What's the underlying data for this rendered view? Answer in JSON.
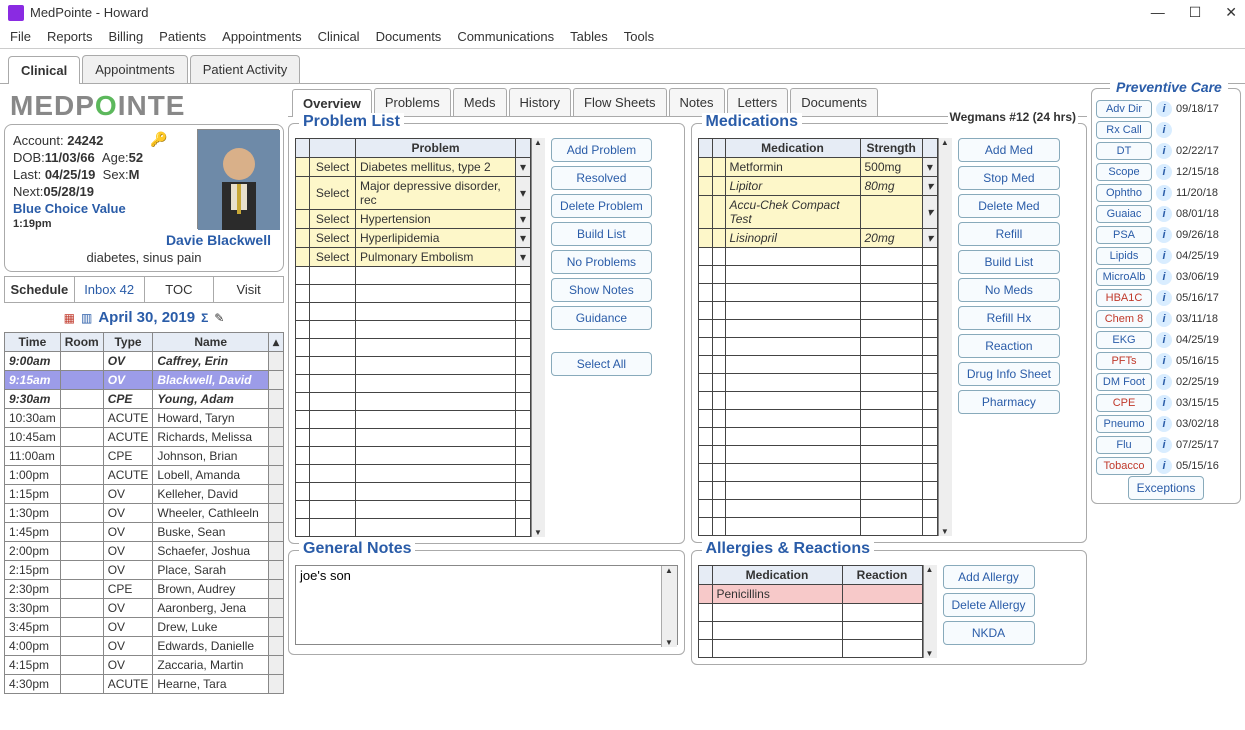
{
  "window": {
    "title": "MedPointe  -  Howard"
  },
  "menubar": [
    "File",
    "Reports",
    "Billing",
    "Patients",
    "Appointments",
    "Clinical",
    "Documents",
    "Communications",
    "Tables",
    "Tools"
  ],
  "main_tabs": [
    "Clinical",
    "Appointments",
    "Patient Activity"
  ],
  "logo": {
    "pre": "MEDP",
    "o": "O",
    "post": "INTE"
  },
  "patient": {
    "account_label": "Account:",
    "account": "24242",
    "dob_label": "DOB:",
    "dob": "11/03/66",
    "age_label": "Age:",
    "age": "52",
    "last_label": "Last:",
    "last": "04/25/19",
    "sex_label": "Sex:",
    "sex": "M",
    "next_label": "Next:",
    "next": "05/28/19",
    "plan": "Blue Choice Value",
    "time": "1:19pm",
    "name": "Davie Blackwell",
    "cc": "diabetes, sinus pain"
  },
  "left_subtabs": {
    "schedule": "Schedule",
    "inbox": "Inbox 42",
    "toc": "TOC",
    "visit": "Visit"
  },
  "date_header": "April 30, 2019",
  "sched_headers": [
    "Time",
    "Room",
    "Type",
    "Name"
  ],
  "schedule": [
    {
      "time": "9:00am",
      "room": "",
      "type": "OV",
      "name": "Caffrey, Erin",
      "bold": true
    },
    {
      "time": "9:15am",
      "room": "",
      "type": "OV",
      "name": "Blackwell, David",
      "selected": true
    },
    {
      "time": "9:30am",
      "room": "",
      "type": "CPE",
      "name": "Young, Adam",
      "bold": true
    },
    {
      "time": "10:30am",
      "room": "",
      "type": "ACUTE",
      "name": "Howard, Taryn"
    },
    {
      "time": "10:45am",
      "room": "",
      "type": "ACUTE",
      "name": "Richards, Melissa"
    },
    {
      "time": "11:00am",
      "room": "",
      "type": "CPE",
      "name": "Johnson, Brian"
    },
    {
      "time": "1:00pm",
      "room": "",
      "type": "ACUTE",
      "name": "Lobell, Amanda"
    },
    {
      "time": "1:15pm",
      "room": "",
      "type": "OV",
      "name": "Kelleher, David"
    },
    {
      "time": "1:30pm",
      "room": "",
      "type": "OV",
      "name": "Wheeler, Cathleeln"
    },
    {
      "time": "1:45pm",
      "room": "",
      "type": "OV",
      "name": "Buske, Sean"
    },
    {
      "time": "2:00pm",
      "room": "",
      "type": "OV",
      "name": "Schaefer, Joshua"
    },
    {
      "time": "2:15pm",
      "room": "",
      "type": "OV",
      "name": "Place, Sarah"
    },
    {
      "time": "2:30pm",
      "room": "",
      "type": "CPE",
      "name": "Brown, Audrey"
    },
    {
      "time": "3:30pm",
      "room": "",
      "type": "OV",
      "name": "Aaronberg, Jena"
    },
    {
      "time": "3:45pm",
      "room": "",
      "type": "OV",
      "name": "Drew, Luke"
    },
    {
      "time": "4:00pm",
      "room": "",
      "type": "OV",
      "name": "Edwards, Danielle"
    },
    {
      "time": "4:15pm",
      "room": "",
      "type": "OV",
      "name": "Zaccaria, Martin"
    },
    {
      "time": "4:30pm",
      "room": "",
      "type": "ACUTE",
      "name": "Hearne, Tara"
    }
  ],
  "center_tabs": [
    "Overview",
    "Problems",
    "Meds",
    "History",
    "Flow Sheets",
    "Notes",
    "Letters",
    "Documents"
  ],
  "problem_list": {
    "title": "Problem List",
    "header": "Problem",
    "select_label": "Select",
    "rows": [
      "Diabetes mellitus, type 2",
      "Major depressive disorder, rec",
      "Hypertension",
      "Hyperlipidemia",
      "Pulmonary Embolism"
    ],
    "buttons": [
      "Add Problem",
      "Resolved",
      "Delete Problem",
      "Build List",
      "No Problems",
      "Show Notes",
      "Guidance",
      "Select All"
    ]
  },
  "medications": {
    "title": "Medications",
    "pharmacy": "Wegmans #12 (24 hrs)",
    "headers": [
      "Medication",
      "Strength"
    ],
    "rows": [
      {
        "name": "Metformin",
        "strength": "500mg",
        "italic": false
      },
      {
        "name": "Lipitor",
        "strength": "80mg",
        "italic": true
      },
      {
        "name": "Accu-Chek Compact Test",
        "strength": "",
        "italic": true
      },
      {
        "name": "Lisinopril",
        "strength": "20mg",
        "italic": true
      }
    ],
    "buttons": [
      "Add Med",
      "Stop Med",
      "Delete Med",
      "Refill",
      "Build List",
      "No Meds",
      "Refill Hx",
      "Reaction",
      "Drug Info Sheet",
      "Pharmacy"
    ]
  },
  "general_notes": {
    "title": "General Notes",
    "text": "joe's son"
  },
  "allergies": {
    "title": "Allergies & Reactions",
    "headers": [
      "Medication",
      "Reaction"
    ],
    "rows": [
      {
        "med": "Penicillins",
        "reaction": ""
      }
    ],
    "buttons": [
      "Add Allergy",
      "Delete Allergy",
      "NKDA"
    ]
  },
  "preventive": {
    "title": "Preventive Care",
    "rows": [
      {
        "label": "Adv Dir",
        "date": "09/18/17",
        "red": false
      },
      {
        "label": "Rx Call",
        "date": "",
        "red": false
      },
      {
        "label": "DT",
        "date": "02/22/17",
        "red": false
      },
      {
        "label": "Scope",
        "date": "12/15/18",
        "red": false
      },
      {
        "label": "Ophtho",
        "date": "11/20/18",
        "red": false
      },
      {
        "label": "Guaiac",
        "date": "08/01/18",
        "red": false
      },
      {
        "label": "PSA",
        "date": "09/26/18",
        "red": false
      },
      {
        "label": "Lipids",
        "date": "04/25/19",
        "red": false
      },
      {
        "label": "MicroAlb",
        "date": "03/06/19",
        "red": false
      },
      {
        "label": "HBA1C",
        "date": "05/16/17",
        "red": true
      },
      {
        "label": "Chem 8",
        "date": "03/11/18",
        "red": true
      },
      {
        "label": "EKG",
        "date": "04/25/19",
        "red": false
      },
      {
        "label": "PFTs",
        "date": "05/16/15",
        "red": true
      },
      {
        "label": "DM Foot",
        "date": "02/25/19",
        "red": false
      },
      {
        "label": "CPE",
        "date": "03/15/15",
        "red": true
      },
      {
        "label": "Pneumo",
        "date": "03/02/18",
        "red": false
      },
      {
        "label": "Flu",
        "date": "07/25/17",
        "red": false
      },
      {
        "label": "Tobacco",
        "date": "05/15/16",
        "red": true
      }
    ],
    "exceptions": "Exceptions"
  }
}
